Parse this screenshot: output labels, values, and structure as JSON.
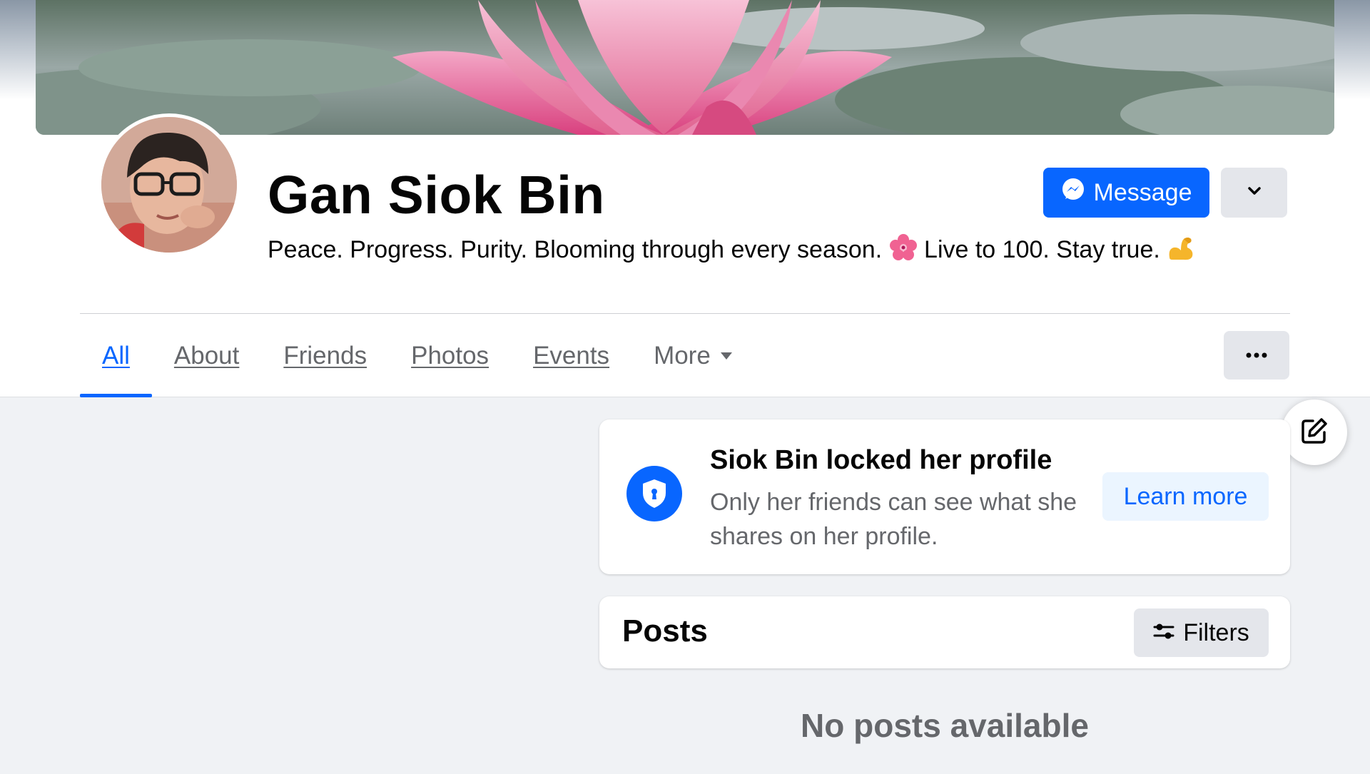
{
  "profile": {
    "name": "Gan Siok Bin",
    "bio_text_1": "Peace. Progress. Purity. Blooming through every season.",
    "bio_text_2": "Live to 100. Stay true.",
    "bio_emoji_1": "cherry-blossom",
    "bio_emoji_2": "flexed-biceps",
    "cover_image": "pink-water-lily",
    "avatar_image": "woman-with-glasses"
  },
  "actions": {
    "message_label": "Message",
    "message_icon": "messenger-icon",
    "dropdown_icon": "chevron-down-icon",
    "more_options_icon": "ellipsis-icon",
    "edit_icon": "edit-icon"
  },
  "tabs": [
    {
      "label": "All",
      "active": true
    },
    {
      "label": "About",
      "active": false
    },
    {
      "label": "Friends",
      "active": false
    },
    {
      "label": "Photos",
      "active": false
    },
    {
      "label": "Events",
      "active": false
    },
    {
      "label": "More",
      "active": false
    }
  ],
  "locked_notice": {
    "title": "Siok Bin locked her profile",
    "description": "Only her friends can see what she shares on her profile.",
    "button_label": "Learn more",
    "icon": "shield-lock-icon"
  },
  "posts": {
    "title": "Posts",
    "filters_label": "Filters",
    "filters_icon": "sliders-icon",
    "empty_message": "No posts available"
  },
  "colors": {
    "accent": "#0866ff",
    "background": "#f0f2f5",
    "secondary_text": "#65676b",
    "button_gray": "#e4e6eb",
    "learn_more_bg": "#ebf5ff"
  }
}
